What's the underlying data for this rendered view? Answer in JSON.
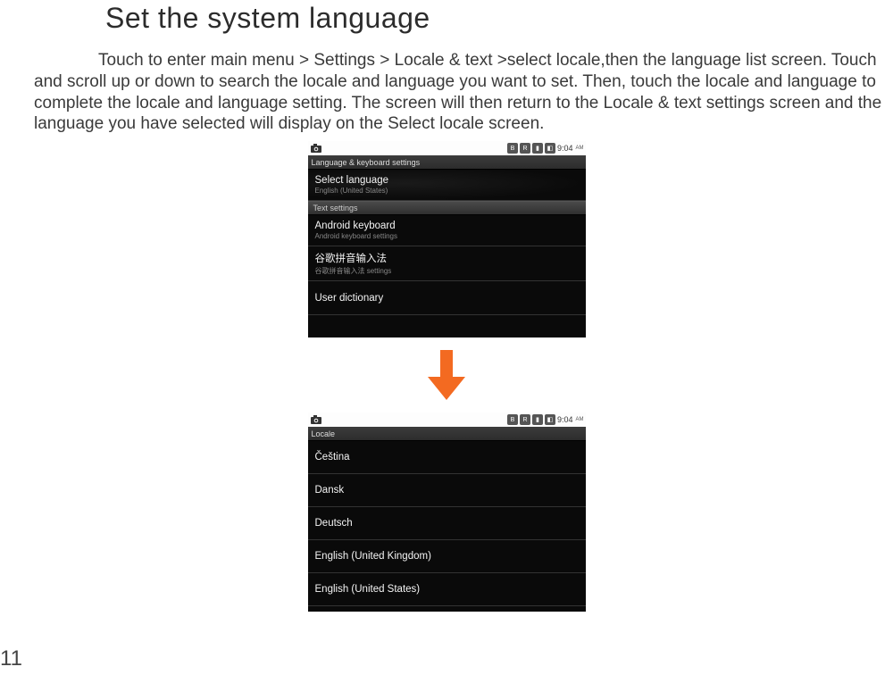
{
  "heading": "Set the system language",
  "body": "Touch to enter main menu > Settings > Locale & text >select locale,then the language list screen. Touch and scroll up or down to search the locale and language you want to set. Then, touch the locale and language to complete the locale and language setting. The screen will then return to the Locale & text settings screen and the language you have selected will display on the Select locale screen.",
  "page_number": "11",
  "statusbar": {
    "time": "9:04",
    "ampm": "AM",
    "bt": "B",
    "sim": "R",
    "sig": "▮",
    "batt": "◧"
  },
  "screenshot1": {
    "header": "Language & keyboard settings",
    "row1_title": "Select language",
    "row1_sub": "English (United States)",
    "section_text": "Text settings",
    "row2_title": "Android keyboard",
    "row2_sub": "Android keyboard settings",
    "row3_title": "谷歌拼音输入法",
    "row3_sub": "谷歌拼音输入法 settings",
    "row4_title": "User dictionary"
  },
  "screenshot2": {
    "header": "Locale",
    "items": [
      "Čeština",
      "Dansk",
      "Deutsch",
      "English (United Kingdom)",
      "English (United States)"
    ]
  }
}
